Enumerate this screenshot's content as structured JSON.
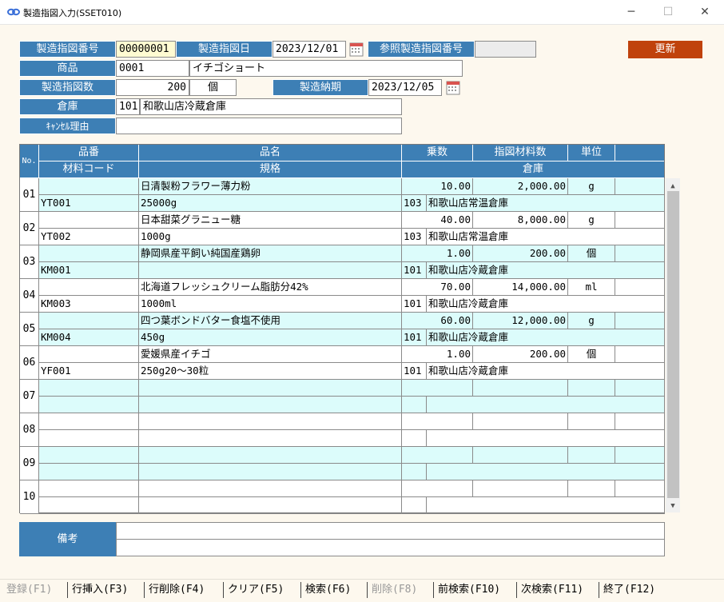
{
  "window": {
    "title": "製造指図入力(SSET010)",
    "minimize": "─",
    "maximize": "☐",
    "close": "✕"
  },
  "header": {
    "order_no_label": "製造指図番号",
    "order_no": "00000001",
    "order_date_label": "製造指図日",
    "order_date": "2023/12/01",
    "ref_no_label": "参照製造指図番号",
    "ref_no": "",
    "update_button": "更新",
    "product_label": "商品",
    "product_code": "0001",
    "product_name": "イチゴショート",
    "qty_label": "製造指図数",
    "qty": "200",
    "qty_unit": "個",
    "due_label": "製造納期",
    "due_date": "2023/12/05",
    "warehouse_label": "倉庫",
    "warehouse_code": "101",
    "warehouse_name": "和歌山店冷蔵倉庫",
    "cancel_label": "ｷｬﾝｾﾙ理由",
    "cancel_reason": ""
  },
  "grid": {
    "headers": {
      "no": "No.",
      "item_no": "品番",
      "item_name": "品名",
      "multiplier": "乗数",
      "material_qty": "指図材料数",
      "unit": "単位",
      "material_code": "材料コード",
      "spec": "規格",
      "warehouse": "倉庫"
    },
    "rows": [
      {
        "no": "01",
        "name": "日清製粉フラワー薄力粉",
        "mult": "10.00",
        "qty": "2,000.00",
        "unit": "g",
        "code": "YT001",
        "spec": "25000g",
        "wh_code": "103",
        "wh_name": "和歌山店常温倉庫"
      },
      {
        "no": "02",
        "name": "日本甜菜グラニュー糖",
        "mult": "40.00",
        "qty": "8,000.00",
        "unit": "g",
        "code": "YT002",
        "spec": "1000g",
        "wh_code": "103",
        "wh_name": "和歌山店常温倉庫"
      },
      {
        "no": "03",
        "name": "静岡県産平飼い純国産鶏卵",
        "mult": "1.00",
        "qty": "200.00",
        "unit": "個",
        "code": "KM001",
        "spec": "",
        "wh_code": "101",
        "wh_name": "和歌山店冷蔵倉庫"
      },
      {
        "no": "04",
        "name": "北海道フレッシュクリーム脂肪分42%",
        "mult": "70.00",
        "qty": "14,000.00",
        "unit": "ml",
        "code": "KM003",
        "spec": "1000ml",
        "wh_code": "101",
        "wh_name": "和歌山店冷蔵倉庫"
      },
      {
        "no": "05",
        "name": "四つ葉ボンドバター食塩不使用",
        "mult": "60.00",
        "qty": "12,000.00",
        "unit": "g",
        "code": "KM004",
        "spec": "450g",
        "wh_code": "101",
        "wh_name": "和歌山店冷蔵倉庫"
      },
      {
        "no": "06",
        "name": "愛媛県産イチゴ",
        "mult": "1.00",
        "qty": "200.00",
        "unit": "個",
        "code": "YF001",
        "spec": "250g20～30粒",
        "wh_code": "101",
        "wh_name": "和歌山店冷蔵倉庫"
      },
      {
        "no": "07",
        "name": "",
        "mult": "",
        "qty": "",
        "unit": "",
        "code": "",
        "spec": "",
        "wh_code": "",
        "wh_name": ""
      },
      {
        "no": "08",
        "name": "",
        "mult": "",
        "qty": "",
        "unit": "",
        "code": "",
        "spec": "",
        "wh_code": "",
        "wh_name": ""
      },
      {
        "no": "09",
        "name": "",
        "mult": "",
        "qty": "",
        "unit": "",
        "code": "",
        "spec": "",
        "wh_code": "",
        "wh_name": ""
      },
      {
        "no": "10",
        "name": "",
        "mult": "",
        "qty": "",
        "unit": "",
        "code": "",
        "spec": "",
        "wh_code": "",
        "wh_name": ""
      }
    ]
  },
  "remarks": {
    "label": "備考",
    "line1": "",
    "line2": ""
  },
  "fkeys": [
    {
      "label": "登録(F1)",
      "enabled": false
    },
    {
      "label": "行挿入(F3)",
      "enabled": true
    },
    {
      "label": "行削除(F4)",
      "enabled": true
    },
    {
      "label": "クリア(F5)",
      "enabled": true
    },
    {
      "label": "検索(F6)",
      "enabled": true
    },
    {
      "label": "削除(F8)",
      "enabled": false
    },
    {
      "label": "前検索(F10)",
      "enabled": true
    },
    {
      "label": "次検索(F11)",
      "enabled": true
    },
    {
      "label": "終了(F12)",
      "enabled": true
    }
  ],
  "colors": {
    "label_blue": "#3d7fb5",
    "update_red": "#c0420c",
    "row_tint": "#dcfcfb",
    "window_bg": "#fdf8ee"
  },
  "icons": {
    "app": "infinity-link-icon",
    "calendar": "calendar-icon",
    "scroll_up": "chevron-up-icon",
    "scroll_down": "chevron-down-icon"
  }
}
